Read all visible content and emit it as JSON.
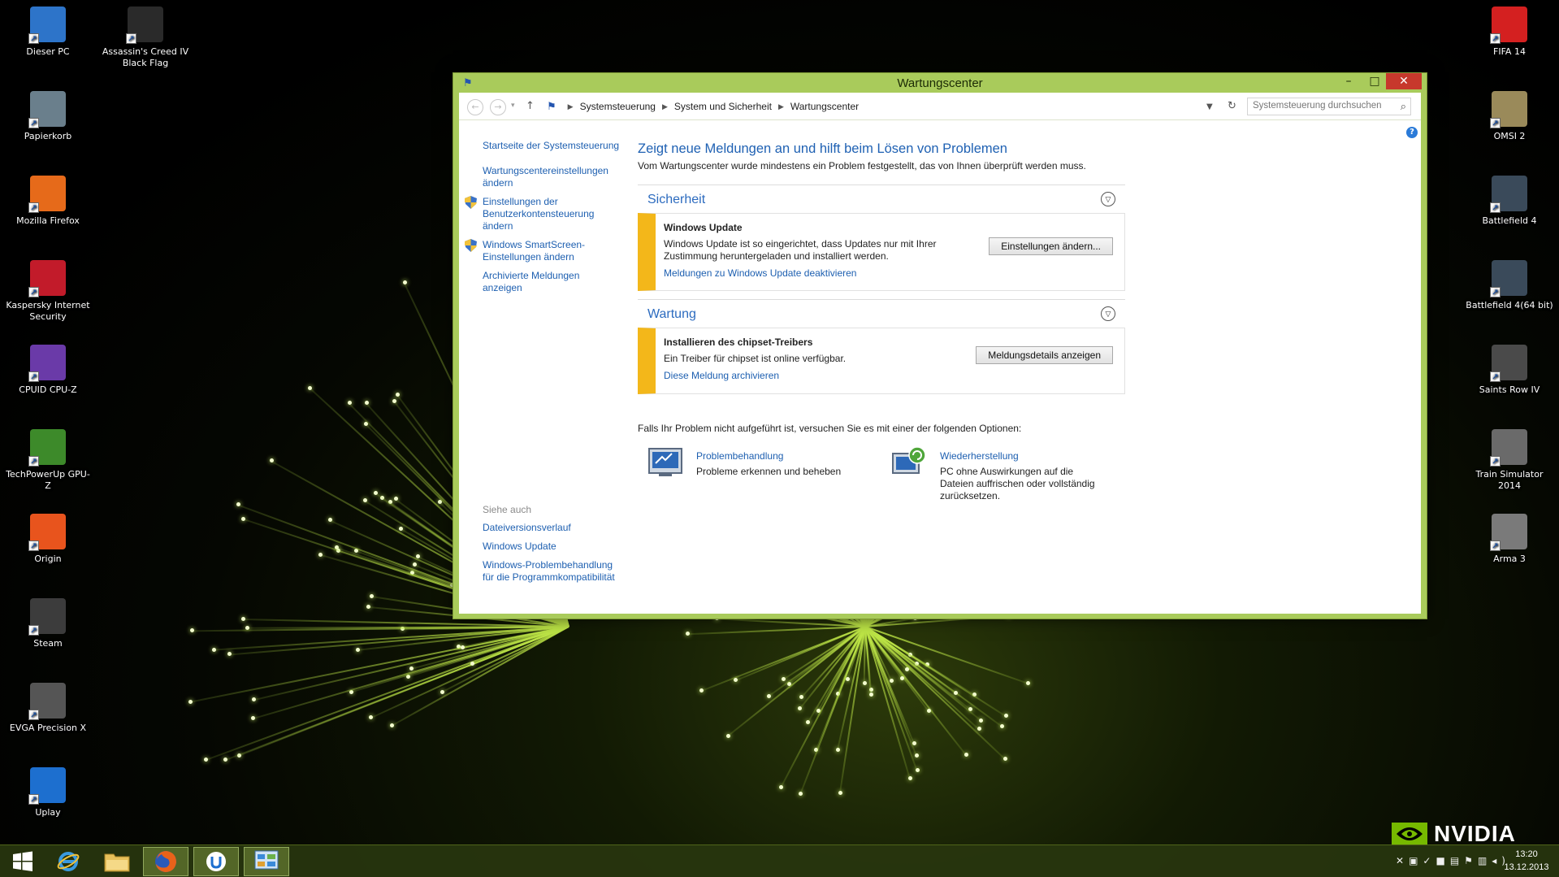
{
  "desktop": {
    "left_icons": [
      {
        "label": "Dieser PC",
        "icon": "computer-icon",
        "color": "#2d74c9"
      },
      {
        "label": "Papierkorb",
        "icon": "recycle-bin-icon",
        "color": "#6a7f8c"
      },
      {
        "label": "Mozilla Firefox",
        "icon": "firefox-icon",
        "color": "#e66a1a"
      },
      {
        "label": "Kaspersky Internet Security",
        "icon": "kaspersky-icon",
        "color": "#c21b2a"
      },
      {
        "label": "CPUID CPU-Z",
        "icon": "cpuz-icon",
        "color": "#6a3aa8"
      },
      {
        "label": "TechPowerUp GPU-Z",
        "icon": "gpuz-icon",
        "color": "#3d8a2a"
      },
      {
        "label": "Origin",
        "icon": "origin-icon",
        "color": "#e8541d"
      },
      {
        "label": "Steam",
        "icon": "steam-icon",
        "color": "#3c3c3c"
      },
      {
        "label": "EVGA Precision X",
        "icon": "evga-icon",
        "color": "#555555"
      },
      {
        "label": "Uplay",
        "icon": "uplay-icon",
        "color": "#1d6fcf"
      }
    ],
    "second_column": [
      {
        "label": "Assassin's Creed IV Black Flag",
        "icon": "assassins-creed-icon",
        "color": "#2a2a2a"
      }
    ],
    "right_icons": [
      {
        "label": "FIFA 14",
        "icon": "fifa-icon",
        "color": "#d42020"
      },
      {
        "label": "OMSI 2",
        "icon": "omsi-icon",
        "color": "#9a8a5a"
      },
      {
        "label": "Battlefield 4",
        "icon": "battlefield-icon",
        "color": "#3a4a5a"
      },
      {
        "label": "Battlefield 4(64 bit)",
        "icon": "battlefield-icon",
        "color": "#3a4a5a"
      },
      {
        "label": "Saints Row IV",
        "icon": "saints-row-icon",
        "color": "#4a4a4a"
      },
      {
        "label": "Train Simulator 2014",
        "icon": "train-simulator-icon",
        "color": "#6a6a6a"
      },
      {
        "label": "Arma 3",
        "icon": "arma-icon",
        "color": "#7a7a7a"
      }
    ],
    "nvidia": "NVIDIA"
  },
  "window": {
    "title": "Wartungscenter",
    "controls": {
      "minimize": "–",
      "maximize": "□",
      "close": "✕"
    },
    "breadcrumb": [
      "Systemsteuerung",
      "System und Sicherheit",
      "Wartungscenter"
    ],
    "search_placeholder": "Systemsteuerung durchsuchen",
    "sidebar": {
      "links": [
        {
          "label": "Startseite der Systemsteuerung",
          "shield": false
        },
        {
          "label": "Wartungscentereinstellungen ändern",
          "shield": false
        },
        {
          "label": "Einstellungen der Benutzerkontensteuerung ändern",
          "shield": true
        },
        {
          "label": "Windows SmartScreen-Einstellungen ändern",
          "shield": true
        },
        {
          "label": "Archivierte Meldungen anzeigen",
          "shield": false
        }
      ],
      "see_also_heading": "Siehe auch",
      "see_also": [
        "Dateiversionsverlauf",
        "Windows Update",
        "Windows-Problembehandlung für die Programmkompatibilität"
      ]
    },
    "main": {
      "heading": "Zeigt neue Meldungen an und hilft beim Lösen von Problemen",
      "subheading": "Vom Wartungscenter wurde mindestens ein Problem festgestellt, das von Ihnen überprüft werden muss.",
      "sections": [
        {
          "title": "Sicherheit",
          "card": {
            "title": "Windows Update",
            "description": "Windows Update ist so eingerichtet, dass Updates nur mit Ihrer Zustimmung heruntergeladen und installiert werden.",
            "link": "Meldungen zu Windows Update deaktivieren",
            "button": "Einstellungen ändern..."
          }
        },
        {
          "title": "Wartung",
          "card": {
            "title": "Installieren des chipset-Treibers",
            "description": "Ein Treiber für chipset ist online verfügbar.",
            "link": "Diese Meldung archivieren",
            "button": "Meldungsdetails anzeigen"
          }
        }
      ],
      "options_text": "Falls Ihr Problem nicht aufgeführt ist, versuchen Sie es mit einer der folgenden Optionen:",
      "options": [
        {
          "title": "Problembehandlung",
          "description": "Probleme erkennen und beheben"
        },
        {
          "title": "Wiederherstellung",
          "description": "PC ohne Auswirkungen auf die Dateien auffrischen oder vollständig zurücksetzen."
        }
      ]
    },
    "accent_color": "#a9cb5b",
    "warning_color": "#f3b71a"
  },
  "taskbar": {
    "items": [
      {
        "name": "start-button",
        "icon": "windows-logo-icon"
      },
      {
        "name": "internet-explorer",
        "icon": "internet-explorer-icon"
      },
      {
        "name": "file-explorer",
        "icon": "folder-icon"
      },
      {
        "name": "firefox",
        "icon": "firefox-icon"
      },
      {
        "name": "uplay",
        "icon": "uplay-icon"
      },
      {
        "name": "control-panel",
        "icon": "control-panel-icon"
      }
    ],
    "clock": {
      "time": "13:20",
      "date": "13.12.2013"
    }
  }
}
